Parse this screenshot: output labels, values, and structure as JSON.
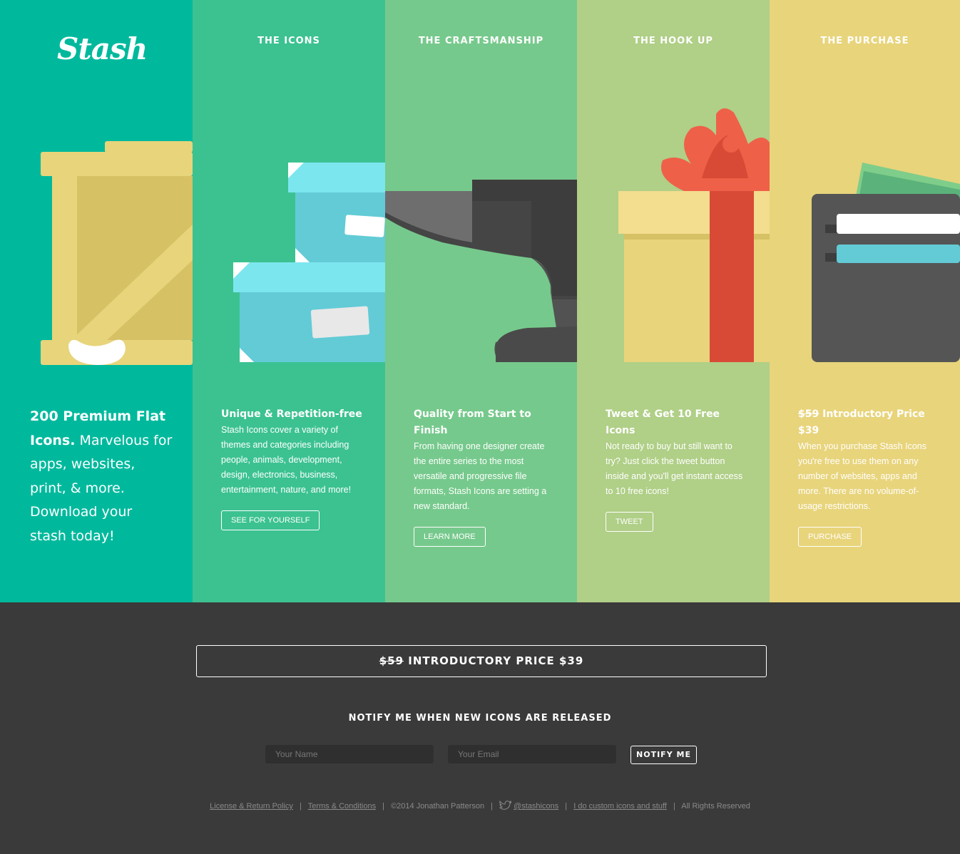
{
  "brand": {
    "logo": "Stash"
  },
  "intro": {
    "bold": "200 Premium Flat Icons.",
    "text": " Marvelous for apps, websites, print, & more. Download your stash today!"
  },
  "columns": [
    {
      "title": "THE ICONS",
      "heading": "Unique & Repetition-free",
      "body": "Stash Icons cover a variety of themes and categories including people, animals, development, design, electronics, business, entertainment, nature, and more!",
      "button": "SEE FOR YOURSELF",
      "icon": "boxes-icon"
    },
    {
      "title": "THE CRAFTSMANSHIP",
      "heading": "Quality from Start to Finish",
      "body": "From having one designer create the entire series to the most versatile and progressive file formats, Stash Icons are setting a new standard.",
      "button": "LEARN MORE",
      "icon": "anvil-icon"
    },
    {
      "title": "THE HOOK UP",
      "heading": "Tweet & Get 10 Free Icons",
      "body": "Not ready to buy but still want to try? Just click the tweet button inside and you'll get instant access to 10 free icons!",
      "button": "TWEET",
      "icon": "gift-icon"
    },
    {
      "title": "THE PURCHASE",
      "heading_strike": "$59",
      "heading_rest": " Introductory Price $39",
      "body": "When you purchase Stash Icons you're free to use them on any number of websites, apps and more. There are no volume-of-usage restrictions.",
      "button": "PURCHASE",
      "icon": "wallet-icon"
    }
  ],
  "crate_icon": "crate-icon",
  "price_bar": {
    "strike": "$59",
    "rest": " INTRODUCTORY PRICE $39"
  },
  "notify": {
    "title": "NOTIFY ME WHEN NEW ICONS ARE RELEASED",
    "name_placeholder": "Your Name",
    "email_placeholder": "Your Email",
    "button": "NOTIFY ME"
  },
  "footer": {
    "license": "License & Return Policy",
    "terms": "Terms & Conditions",
    "copyright": "©2014 Jonathan Patterson",
    "twitter": "@stashicons",
    "custom": "I do custom icons and stuff",
    "rights": "All Rights Reserved",
    "twitter_icon": "twitter-bird-icon"
  },
  "colors": {
    "col1": "#00b99d",
    "col2": "#3cc291",
    "col3": "#76c98c",
    "col4": "#b0cf87",
    "col5": "#e8d47b",
    "bottom": "#3a3a3a"
  }
}
